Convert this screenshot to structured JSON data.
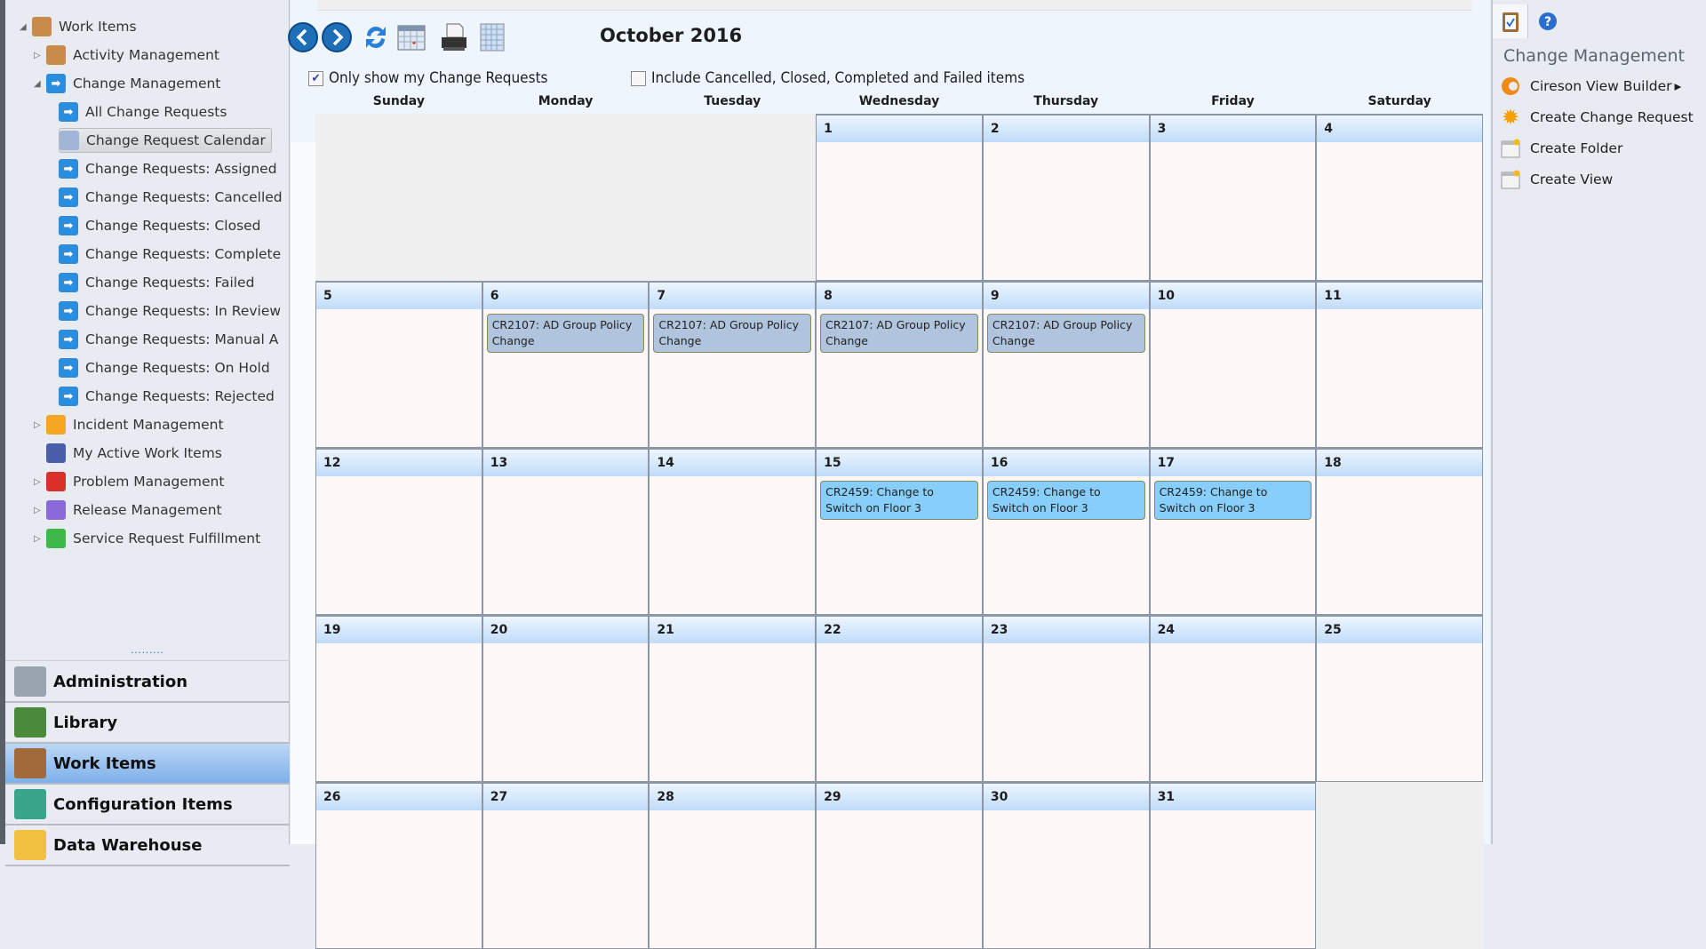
{
  "tree": [
    {
      "label": "Work Items",
      "level": 0,
      "expander": "expanded",
      "icon": "work-items-icon",
      "color": "#c98b4a"
    },
    {
      "label": "Activity Management",
      "level": 1,
      "expander": "collapsed",
      "icon": "activity-icon",
      "color": "#c98b4a"
    },
    {
      "label": "Change Management",
      "level": 1,
      "expander": "expanded",
      "icon": "change-icon",
      "color": "#2a8ee0"
    },
    {
      "label": "All Change Requests",
      "level": 2,
      "icon": "change-icon",
      "color": "#2a8ee0"
    },
    {
      "label": "Change Request Calendar",
      "level": 2,
      "icon": "calendar-icon",
      "color": "#9fb6d6",
      "selected": true
    },
    {
      "label": "Change Requests: Assigned",
      "level": 2,
      "icon": "change-assigned-icon",
      "color": "#2a8ee0"
    },
    {
      "label": "Change Requests: Cancelled",
      "level": 2,
      "icon": "change-cancelled-icon",
      "color": "#2a8ee0"
    },
    {
      "label": "Change Requests: Closed",
      "level": 2,
      "icon": "change-closed-icon",
      "color": "#2a8ee0"
    },
    {
      "label": "Change Requests: Complete",
      "level": 2,
      "icon": "change-complete-icon",
      "color": "#2a8ee0"
    },
    {
      "label": "Change Requests: Failed",
      "level": 2,
      "icon": "change-failed-icon",
      "color": "#2a8ee0"
    },
    {
      "label": "Change Requests: In Review",
      "level": 2,
      "icon": "change-review-icon",
      "color": "#2a8ee0"
    },
    {
      "label": "Change Requests: Manual A",
      "level": 2,
      "icon": "change-manual-icon",
      "color": "#2a8ee0"
    },
    {
      "label": "Change Requests: On Hold",
      "level": 2,
      "icon": "change-hold-icon",
      "color": "#2a8ee0"
    },
    {
      "label": "Change Requests: Rejected",
      "level": 2,
      "icon": "change-rejected-icon",
      "color": "#2a8ee0"
    },
    {
      "label": "Incident Management",
      "level": 1,
      "expander": "collapsed",
      "icon": "incident-icon",
      "color": "#f5a623"
    },
    {
      "label": "My Active Work Items",
      "level": 1,
      "icon": "my-work-items-icon",
      "color": "#4a5fa8"
    },
    {
      "label": "Problem Management",
      "level": 1,
      "expander": "collapsed",
      "icon": "problem-icon",
      "color": "#d9302c"
    },
    {
      "label": "Release Management",
      "level": 1,
      "expander": "collapsed",
      "icon": "release-icon",
      "color": "#8a6ad8"
    },
    {
      "label": "Service Request Fulfillment",
      "level": 1,
      "expander": "collapsed",
      "icon": "service-request-icon",
      "color": "#3fb84a"
    }
  ],
  "splitter": "·········",
  "nav": [
    {
      "label": "Administration",
      "icon": "administration-icon",
      "color": "#9aa4b0"
    },
    {
      "label": "Library",
      "icon": "library-icon",
      "color": "#4a8a3a"
    },
    {
      "label": "Work Items",
      "icon": "work-items-icon",
      "color": "#a06a3a",
      "selected": true
    },
    {
      "label": "Configuration Items",
      "icon": "configuration-items-icon",
      "color": "#3aa58a"
    },
    {
      "label": "Data Warehouse",
      "icon": "data-warehouse-icon",
      "color": "#f0c040"
    }
  ],
  "toolbar": {
    "title": "October 2016",
    "only_mine": "Only show my Change Requests",
    "only_mine_checked": true,
    "include_closed": "Include Cancelled, Closed, Completed and Failed items",
    "include_closed_checked": false
  },
  "calendar": {
    "days": [
      "Sunday",
      "Monday",
      "Tuesday",
      "Wednesday",
      "Thursday",
      "Friday",
      "Saturday"
    ],
    "first_weekday": 3,
    "num_days": 31,
    "events": [
      {
        "day": 6,
        "text": "CR2107: AD Group Policy Change",
        "color": "#b0c4de"
      },
      {
        "day": 7,
        "text": "CR2107: AD Group Policy Change",
        "color": "#b0c4de"
      },
      {
        "day": 8,
        "text": "CR2107: AD Group Policy Change",
        "color": "#b0c4de"
      },
      {
        "day": 9,
        "text": "CR2107: AD Group Policy Change",
        "color": "#b0c4de"
      },
      {
        "day": 15,
        "text": "CR2459: Change to Switch on Floor 3",
        "color": "#87cefa"
      },
      {
        "day": 16,
        "text": "CR2459: Change to Switch on Floor 3",
        "color": "#87cefa"
      },
      {
        "day": 17,
        "text": "CR2459: Change to Switch on Floor 3",
        "color": "#87cefa"
      }
    ]
  },
  "tasks": {
    "header": "Change Management",
    "items": [
      {
        "label": "Cireson View Builder",
        "icon": "cireson-icon",
        "submenu": true
      },
      {
        "label": "Create Change Request",
        "icon": "sun-icon"
      },
      {
        "label": "Create Folder",
        "icon": "folder-view-icon"
      },
      {
        "label": "Create View",
        "icon": "folder-view-icon"
      }
    ],
    "submenu_glyph": "▸"
  }
}
